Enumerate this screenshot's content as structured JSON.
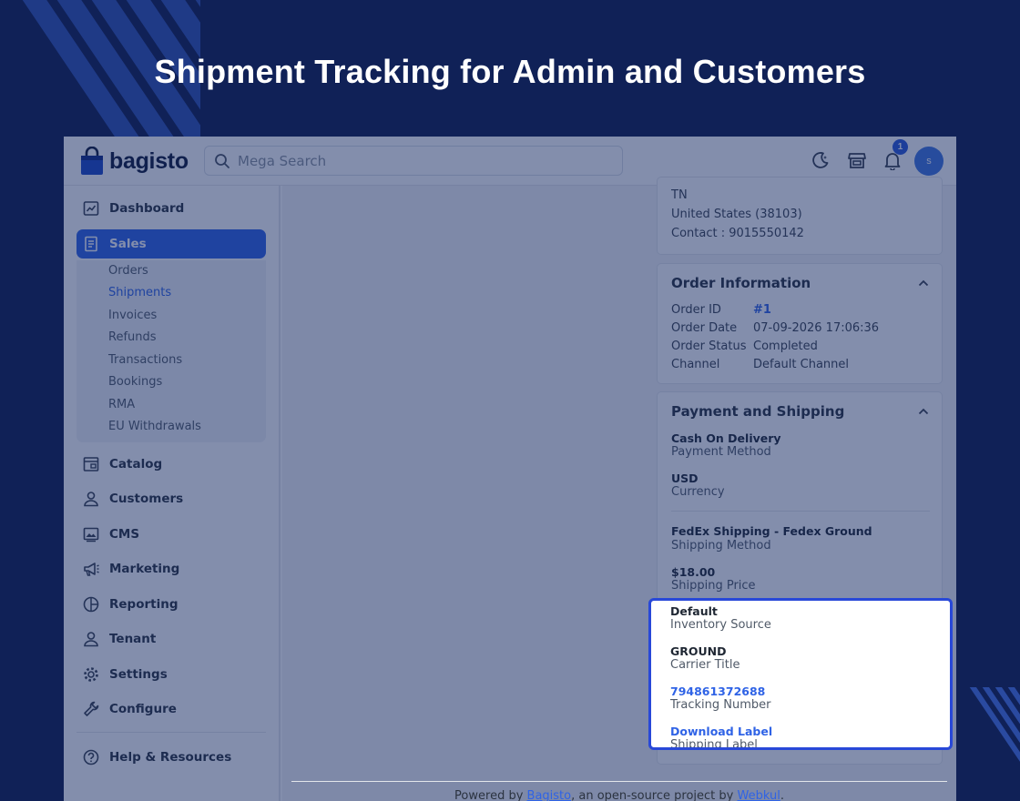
{
  "headline": "Shipment Tracking for Admin and Customers",
  "app": {
    "logo_text": "bagisto",
    "search_placeholder": "Mega Search",
    "notification_count": "1",
    "avatar_initial": "s"
  },
  "sidebar": {
    "items": [
      {
        "label": "Dashboard",
        "icon": "dashboard-icon"
      },
      {
        "label": "Sales",
        "icon": "sales-icon"
      },
      {
        "label": "Catalog",
        "icon": "catalog-icon"
      },
      {
        "label": "Customers",
        "icon": "customers-icon"
      },
      {
        "label": "CMS",
        "icon": "cms-icon"
      },
      {
        "label": "Marketing",
        "icon": "marketing-icon"
      },
      {
        "label": "Reporting",
        "icon": "reporting-icon"
      },
      {
        "label": "Tenant",
        "icon": "tenant-icon"
      },
      {
        "label": "Settings",
        "icon": "settings-icon"
      },
      {
        "label": "Configure",
        "icon": "configure-icon"
      },
      {
        "label": "Help & Resources",
        "icon": "help-icon"
      }
    ],
    "sales_sub": [
      "Orders",
      "Shipments",
      "Invoices",
      "Refunds",
      "Transactions",
      "Bookings",
      "RMA",
      "EU Withdrawals"
    ]
  },
  "address": {
    "state": "TN",
    "country_zip": "United States (38103)",
    "contact": "Contact : 9015550142"
  },
  "order_info": {
    "title": "Order Information",
    "rows": [
      {
        "label": "Order ID",
        "value": "#1"
      },
      {
        "label": "Order Date",
        "value": "07-09-2026 17:06:36"
      },
      {
        "label": "Order Status",
        "value": "Completed"
      },
      {
        "label": "Channel",
        "value": "Default Channel"
      }
    ]
  },
  "payment_shipping": {
    "title": "Payment and Shipping",
    "payment_method": {
      "value": "Cash On Delivery",
      "label": "Payment Method"
    },
    "currency": {
      "value": "USD",
      "label": "Currency"
    },
    "shipping_method": {
      "value": "FedEx Shipping - Fedex Ground",
      "label": "Shipping Method"
    },
    "shipping_price": {
      "value": "$18.00",
      "label": "Shipping Price"
    },
    "inventory_source": {
      "value": "Default",
      "label": "Inventory Source"
    },
    "carrier_title": {
      "value": "GROUND",
      "label": "Carrier Title"
    },
    "tracking_number": {
      "value": "794861372688",
      "label": "Tracking Number"
    },
    "shipping_label": {
      "value": "Download Label",
      "label": "Shipping Label"
    }
  },
  "footer": {
    "prefix": "Powered by ",
    "brand": "Bagisto",
    "middle": ", an open-source project by ",
    "company": "Webkul",
    "suffix": "."
  },
  "colors": {
    "background": "#102157",
    "accent": "#2f63e6",
    "highlight_border": "#2848d8"
  }
}
